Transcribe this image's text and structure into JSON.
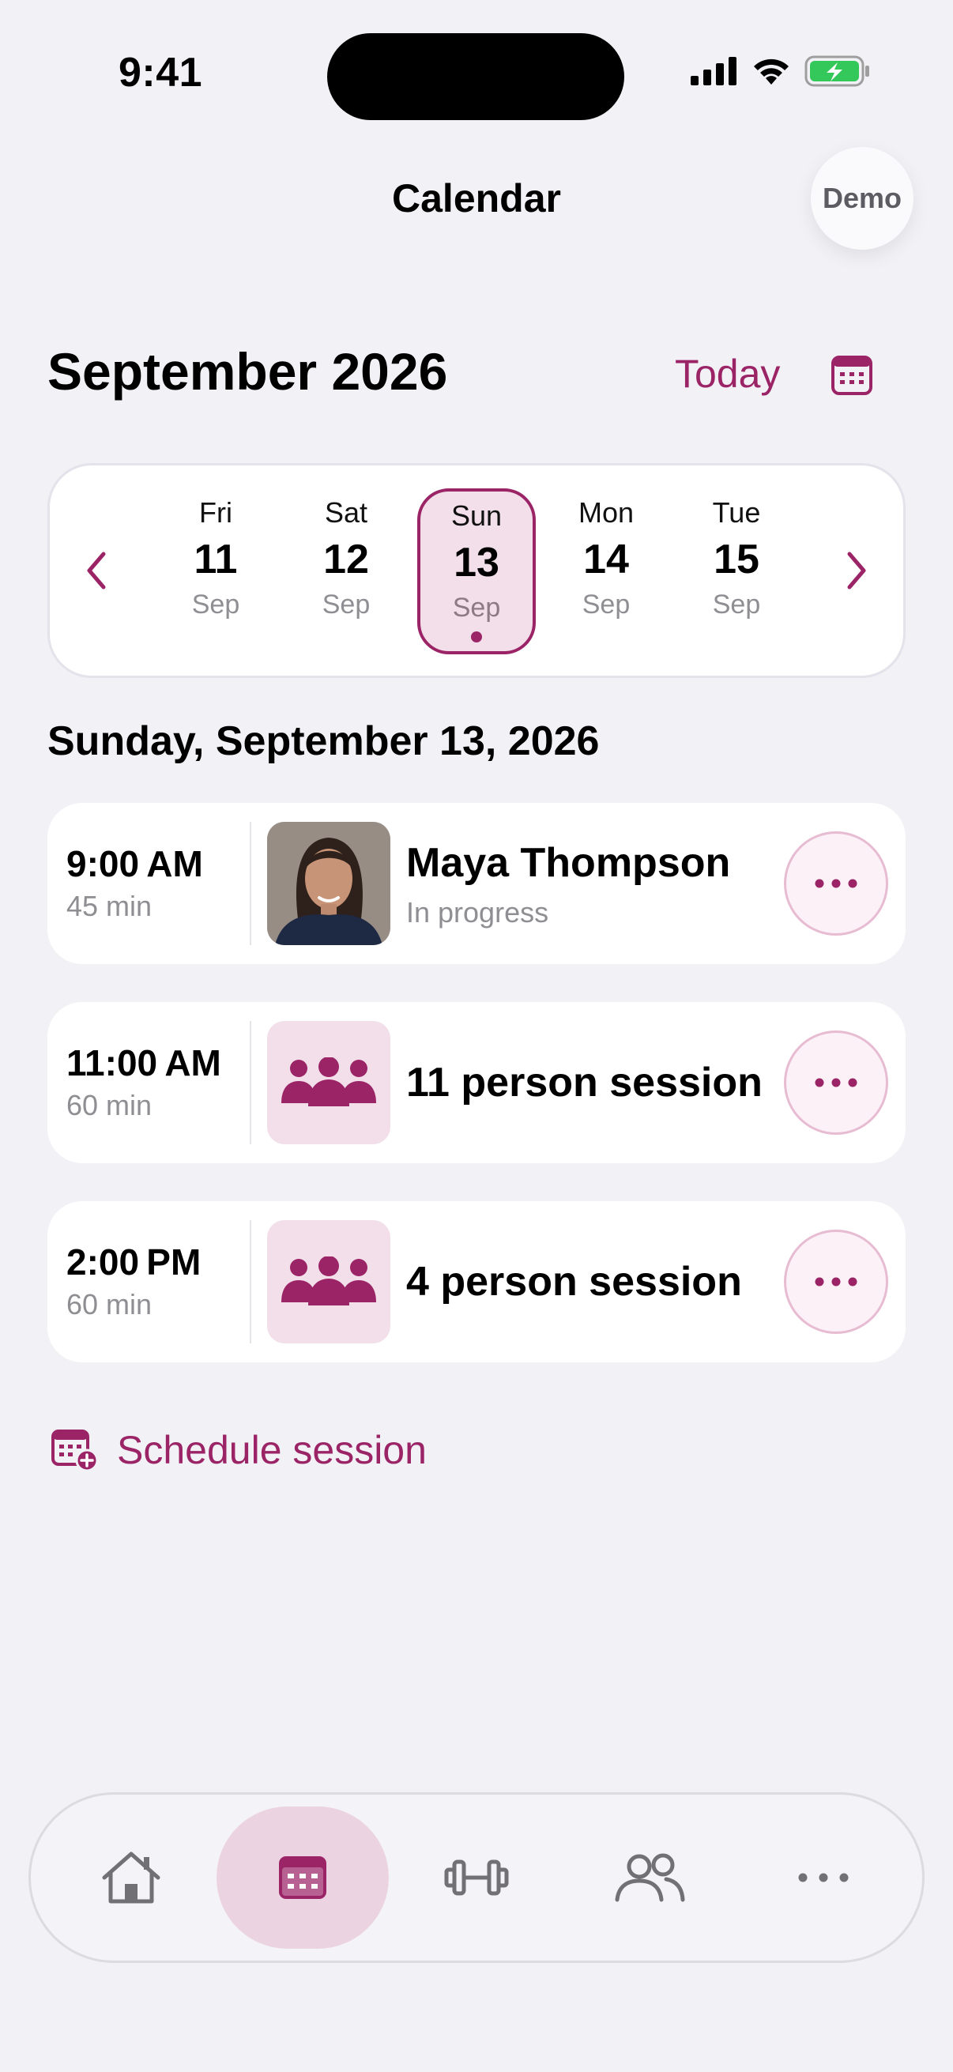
{
  "status": {
    "time": "9:41"
  },
  "header": {
    "title": "Calendar",
    "demo_label": "Demo"
  },
  "month": {
    "title": "September 2026",
    "today_label": "Today"
  },
  "week": {
    "days": [
      {
        "dow": "Fri",
        "num": "11",
        "mon": "Sep",
        "selected": false
      },
      {
        "dow": "Sat",
        "num": "12",
        "mon": "Sep",
        "selected": false
      },
      {
        "dow": "Sun",
        "num": "13",
        "mon": "Sep",
        "selected": true
      },
      {
        "dow": "Mon",
        "num": "14",
        "mon": "Sep",
        "selected": false
      },
      {
        "dow": "Tue",
        "num": "15",
        "mon": "Sep",
        "selected": false
      }
    ]
  },
  "date_heading": "Sunday, September 13, 2026",
  "sessions": [
    {
      "time": "9:00 AM",
      "duration": "45 min",
      "title": "Maya Thompson",
      "subtitle": "In progress",
      "kind": "client"
    },
    {
      "time": "11:00 AM",
      "duration": "60 min",
      "title": "11 person session",
      "subtitle": "",
      "kind": "group"
    },
    {
      "time": "2:00 PM",
      "duration": "60 min",
      "title": "4 person session",
      "subtitle": "",
      "kind": "group"
    }
  ],
  "schedule_label": "Schedule session",
  "tabs": [
    {
      "icon": "home-icon",
      "active": false
    },
    {
      "icon": "calendar-icon",
      "active": true
    },
    {
      "icon": "dumbbell-icon",
      "active": false
    },
    {
      "icon": "people-icon",
      "active": false
    },
    {
      "icon": "more-icon",
      "active": false
    }
  ],
  "colors": {
    "accent": "#9b2467",
    "accent_soft": "#f3dfe9",
    "background": "#f2f1f6",
    "battery": "#34c759"
  }
}
